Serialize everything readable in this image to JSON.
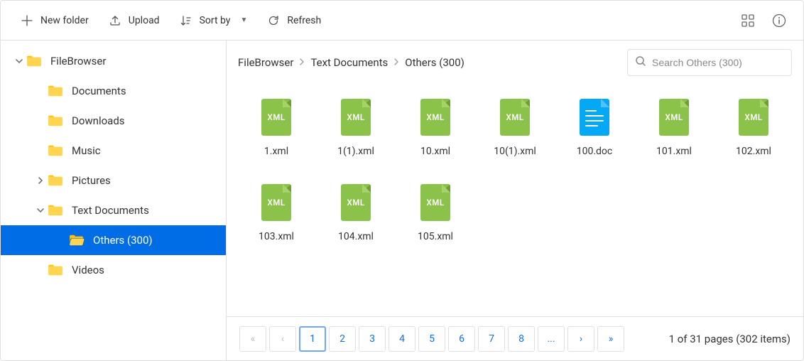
{
  "toolbar": {
    "new_folder": "New folder",
    "upload": "Upload",
    "sort_by": "Sort by",
    "refresh": "Refresh"
  },
  "tree": [
    {
      "label": "FileBrowser",
      "level": 0,
      "arrow": "down",
      "selected": false
    },
    {
      "label": "Documents",
      "level": 1,
      "arrow": "",
      "selected": false
    },
    {
      "label": "Downloads",
      "level": 1,
      "arrow": "",
      "selected": false
    },
    {
      "label": "Music",
      "level": 1,
      "arrow": "",
      "selected": false
    },
    {
      "label": "Pictures",
      "level": 1,
      "arrow": "right",
      "selected": false
    },
    {
      "label": "Text Documents",
      "level": 1,
      "arrow": "down",
      "selected": false
    },
    {
      "label": "Others (300)",
      "level": 2,
      "arrow": "",
      "selected": true
    },
    {
      "label": "Videos",
      "level": 1,
      "arrow": "",
      "selected": false
    }
  ],
  "breadcrumb": [
    "FileBrowser",
    "Text Documents",
    "Others (300)"
  ],
  "search": {
    "placeholder": "Search Others (300)"
  },
  "files": [
    {
      "name": "1.xml",
      "type": "xml"
    },
    {
      "name": "1(1).xml",
      "type": "xml"
    },
    {
      "name": "10.xml",
      "type": "xml"
    },
    {
      "name": "10(1).xml",
      "type": "xml"
    },
    {
      "name": "100.doc",
      "type": "doc"
    },
    {
      "name": "101.xml",
      "type": "xml"
    },
    {
      "name": "102.xml",
      "type": "xml"
    },
    {
      "name": "103.xml",
      "type": "xml"
    },
    {
      "name": "104.xml",
      "type": "xml"
    },
    {
      "name": "105.xml",
      "type": "xml"
    }
  ],
  "pager": {
    "pages": [
      "1",
      "2",
      "3",
      "4",
      "5",
      "6",
      "7",
      "8",
      "..."
    ],
    "active": "1",
    "info": "1 of 31 pages (302 items)"
  },
  "icons": {
    "xml_label": "XML"
  }
}
